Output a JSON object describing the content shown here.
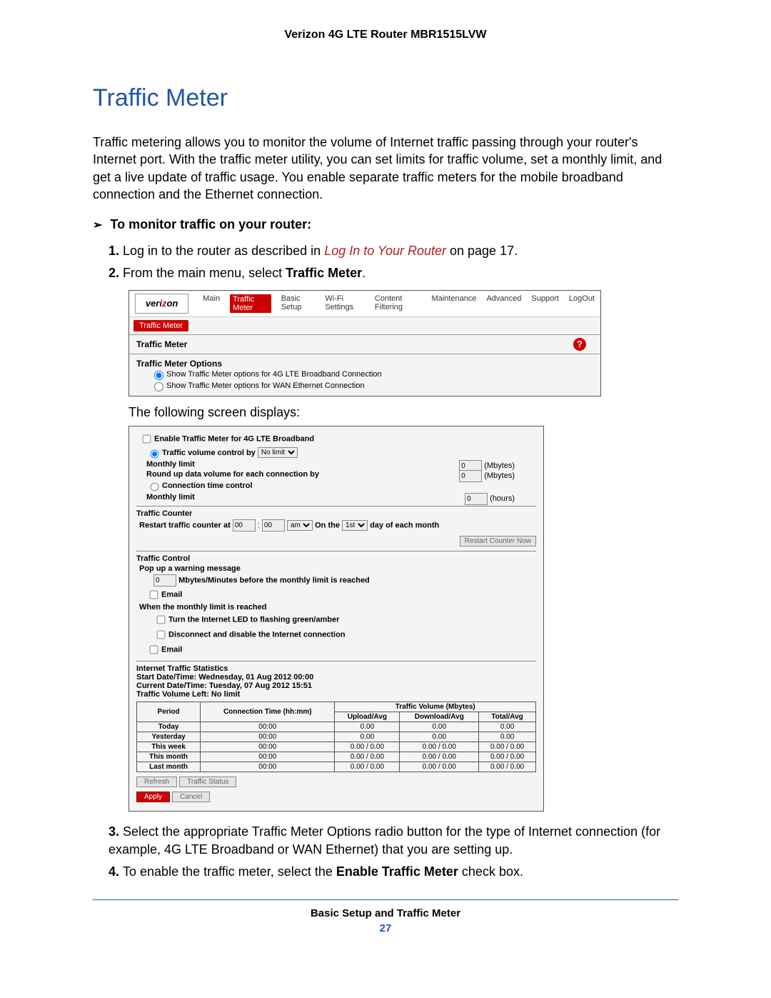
{
  "doc_header": "Verizon 4G LTE Router MBR1515LVW",
  "section_title": "Traffic Meter",
  "intro_para": "Traffic metering allows you to monitor the volume of Internet traffic passing through your router's Internet port. With the traffic meter utility, you can set limits for traffic volume, set a monthly limit, and get a live update of traffic usage. You enable separate traffic meters for the mobile broadband connection and the Ethernet connection.",
  "task_heading": "To monitor traffic on your router:",
  "step1_pre": "Log in to the router as described in ",
  "step1_link": "Log In to Your Router",
  "step1_post": " on page 17.",
  "step2_pre": "From the main menu, select ",
  "step2_bold": "Traffic Meter",
  "step2_post": ".",
  "after_ss1": "The following screen displays:",
  "step3": "Select the appropriate Traffic Meter Options radio button for the type of Internet connection (for example, 4G LTE Broadband or WAN Ethernet) that you are setting up.",
  "step4_pre": "To enable the traffic meter, select the ",
  "step4_bold": "Enable Traffic Meter",
  "step4_post": " check box.",
  "footer": "Basic Setup and Traffic Meter",
  "page_number": "27",
  "ss1": {
    "logo_pre": "veri",
    "logo_z": "z",
    "logo_post": "on",
    "nav": {
      "main": "Main",
      "traffic_meter": "Traffic Meter",
      "basic_setup": "Basic Setup",
      "wifi": "Wi-Fi Settings",
      "content": "Content Filtering",
      "maint": "Maintenance",
      "adv": "Advanced",
      "support": "Support",
      "logout": "LogOut"
    },
    "tab": "Traffic Meter",
    "panel_title": "Traffic Meter",
    "help": "?",
    "options_head": "Traffic Meter Options",
    "opt1": "Show Traffic Meter options for 4G LTE Broadband Connection",
    "opt2": "Show Traffic Meter options for WAN Ethernet Connection"
  },
  "ss2": {
    "enable_cb": "Enable Traffic Meter for 4G LTE Broadband",
    "vol_ctrl_pre": "Traffic volume control by ",
    "vol_ctrl_sel": "No limit",
    "monthly_limit": "Monthly limit",
    "unit_mbytes": "(Mbytes)",
    "round_up": "Round up data volume for each connection by",
    "conn_time": "Connection time control",
    "unit_hours": "(hours)",
    "counter_head": "Traffic Counter",
    "restart_pre": "Restart traffic counter at ",
    "restart_h": "00",
    "restart_m": "00",
    "restart_ampm": "am",
    "restart_mid": " On the ",
    "restart_day": "1st",
    "restart_post": " day of each month",
    "restart_btn": "Restart Counter Now",
    "control_head": "Traffic Control",
    "popup": "Pop up a warning message",
    "popup_val": "0",
    "popup_unit": "Mbytes/Minutes before the monthly limit is reached",
    "email": "Email",
    "when_limit": "When the monthly limit is reached",
    "turn_led": "Turn the Internet LED to flashing green/amber",
    "disconnect": "Disconnect and disable the Internet connection",
    "stats_head": "Internet Traffic Statistics",
    "start_dt": "Start Date/Time: Wednesday, 01 Aug 2012 00:00",
    "current_dt": "Current Date/Time: Tuesday, 07 Aug 2012 15:51",
    "vol_left": "Traffic Volume Left: No limit",
    "table": {
      "h_period": "Period",
      "h_conn": "Connection Time (hh:mm)",
      "h_vol": "Traffic Volume (Mbytes)",
      "h_up": "Upload/Avg",
      "h_down": "Download/Avg",
      "h_total": "Total/Avg",
      "rows": [
        {
          "p": "Today",
          "c": "00:00",
          "u": "0.00",
          "d": "0.00",
          "t": "0.00"
        },
        {
          "p": "Yesterday",
          "c": "00:00",
          "u": "0.00",
          "d": "0.00",
          "t": "0.00"
        },
        {
          "p": "This week",
          "c": "00:00",
          "u": "0.00 / 0.00",
          "d": "0.00 / 0.00",
          "t": "0.00 / 0.00"
        },
        {
          "p": "This month",
          "c": "00:00",
          "u": "0.00 / 0.00",
          "d": "0.00 / 0.00",
          "t": "0.00 / 0.00"
        },
        {
          "p": "Last month",
          "c": "00:00",
          "u": "0.00 / 0.00",
          "d": "0.00 / 0.00",
          "t": "0.00 / 0.00"
        }
      ]
    },
    "btn_refresh": "Refresh",
    "btn_status": "Traffic Status",
    "btn_apply": "Apply",
    "btn_cancel": "Cancel"
  }
}
